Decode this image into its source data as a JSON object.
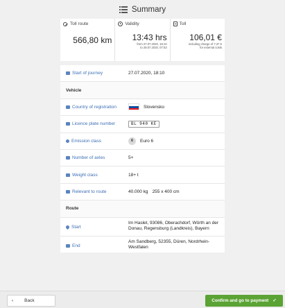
{
  "header": {
    "title": "Summary",
    "icon": "list-icon"
  },
  "tiles": [
    {
      "label": "Toll route",
      "icon": "route-icon",
      "value": "566,80 km",
      "notes": []
    },
    {
      "label": "Validity",
      "icon": "clock-icon",
      "value": "13:43 hrs",
      "notes": [
        "from 27.07.2020, 18:10",
        "to 28.07.2020, 07:53"
      ]
    },
    {
      "label": "Toll",
      "icon": "document-icon",
      "value": "106,01 €",
      "notes": [
        "including charge of 7,37 €",
        "for external costs"
      ]
    }
  ],
  "details": {
    "start_of_journey": {
      "label": "Start of journey",
      "value": "27.07.2020, 18:10"
    },
    "vehicle_section": "Vehicle",
    "country": {
      "label": "Country of registration",
      "value": "Slovensko",
      "flag_colors": [
        "#ffffff",
        "#0b4ea2",
        "#ee1c25"
      ]
    },
    "plate": {
      "label": "Licence plate number",
      "value": "BL 940 KE"
    },
    "emission": {
      "label": "Emission class",
      "badge": "6",
      "value": "Euro 6"
    },
    "axles": {
      "label": "Number of axles",
      "value": "5+"
    },
    "weight": {
      "label": "Weight class",
      "value": "18+ t"
    },
    "relevant": {
      "label": "Relevant to route",
      "weight": "40.000 kg",
      "dimensions": "255 x 400 cm"
    },
    "route_section": "Route",
    "start": {
      "label": "Start",
      "value": "Im Haslet, 93086, Oberachdorf, Wörth an der Donau, Regensburg (Landkreis), Bayern"
    },
    "end": {
      "label": "End",
      "value": "Am Sandberg, 52355, Düren, Nordrhein-Westfalen"
    }
  },
  "footer": {
    "back_label": "Back",
    "pay_label": "Confirm and go to payment",
    "pay_color": "#5aa334"
  }
}
